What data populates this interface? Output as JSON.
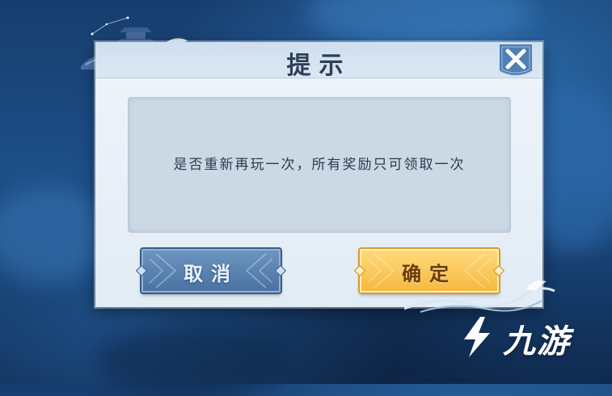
{
  "dialog": {
    "title": "提示",
    "message": "是否重新再玩一次，所有奖励只可领取一次"
  },
  "buttons": {
    "cancel_label": "取消",
    "confirm_label": "确定"
  },
  "close_icon": "close-x-icon",
  "watermark": {
    "text": "九游",
    "logo_icon": "jiuyou-logo-icon"
  },
  "colors": {
    "cancel_button": "#5a82b0",
    "confirm_button": "#f7c65a",
    "title_text": "#2e3f58",
    "dialog_bg": "#e8f0f7"
  }
}
